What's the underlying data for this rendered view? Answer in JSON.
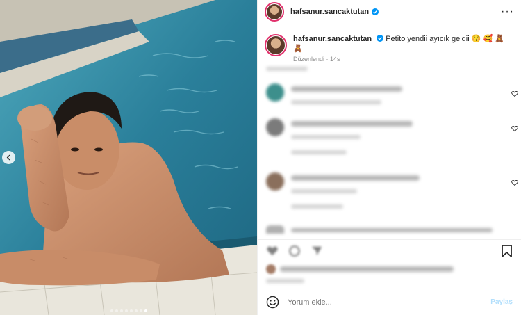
{
  "post": {
    "username": "hafsanur.sancaktutan",
    "verified": true,
    "caption_text": "Petito yendii ayıcık geldii 😚 🥰 🧸 🧸",
    "edited_label": "Düzenlendi",
    "time_ago": "14s",
    "carousel_total": 8,
    "carousel_active_index": 7,
    "more_label": "···"
  },
  "comments": [
    {
      "avatar_color": "#3d8f8c"
    },
    {
      "avatar_color": "#7b7b7b"
    },
    {
      "avatar_color": "#8a6f5c"
    },
    {
      "avatar_color": "#b0b0b0"
    }
  ],
  "composer": {
    "placeholder": "Yorum ekle...",
    "post_label": "Paylaş"
  },
  "colors": {
    "verified_blue": "#0095f6",
    "post_button": "#b2dffc"
  }
}
